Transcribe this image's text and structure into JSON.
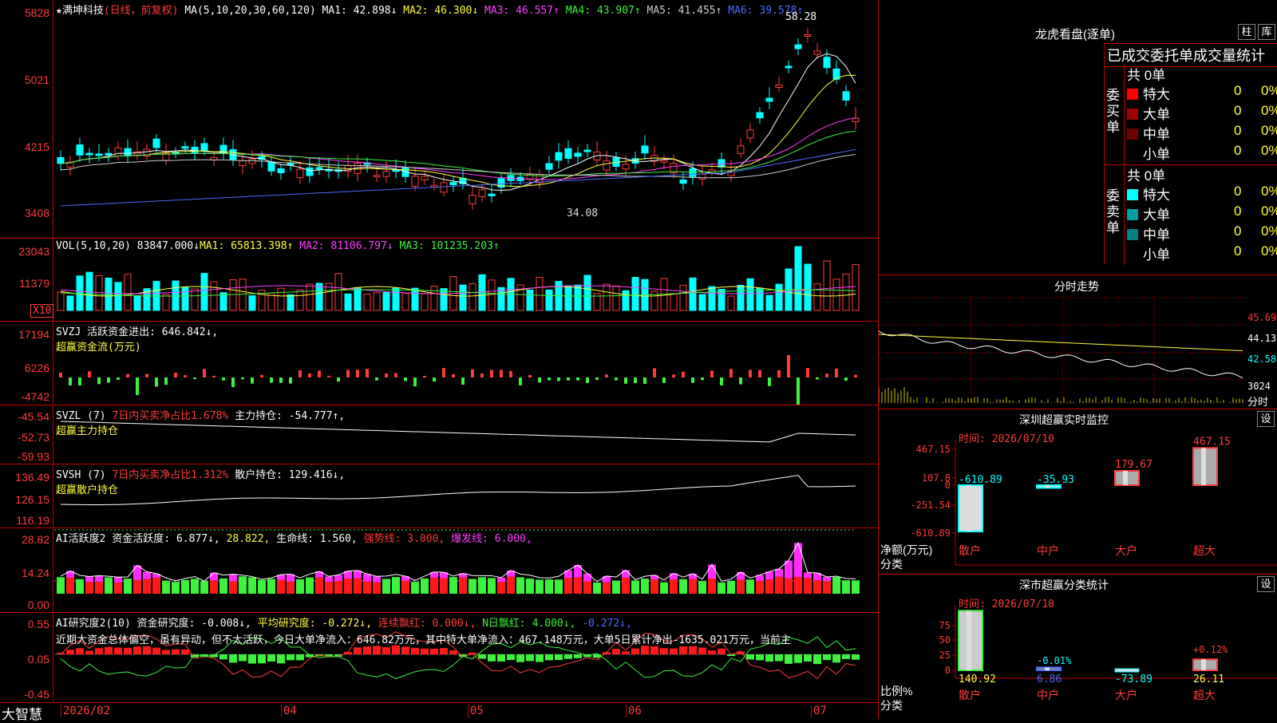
{
  "brand": "大智慧",
  "stock": {
    "name": "★满坤科技",
    "period": "(日线，前复权)"
  },
  "main": {
    "ma_label": "MA(5,10,20,30,60,120)",
    "ma": [
      {
        "label": "MA1: 42.898↓",
        "color": "#ffffff"
      },
      {
        "label": "MA2: 46.300↓",
        "color": "#ffff3c"
      },
      {
        "label": "MA3: 46.557↑",
        "color": "#ff40ff"
      },
      {
        "label": "MA4: 43.907↑",
        "color": "#3cf23c"
      },
      {
        "label": "MA5: 41.455↑",
        "color": "#cccccc"
      },
      {
        "label": "MA6: 39.578↑",
        "color": "#4b6bff"
      }
    ],
    "yticks": [
      "5828",
      "5021",
      "4215",
      "3408"
    ],
    "high_label": "58.28",
    "low_label": "34.08"
  },
  "vol": {
    "label": "VOL(5,10,20)",
    "value": "83847.000↓",
    "ma": [
      {
        "label": "MA1: 65813.398↑",
        "color": "#ffff3c"
      },
      {
        "label": "MA2: 81106.797↓",
        "color": "#ff40ff"
      },
      {
        "label": "MA3: 101235.203↑",
        "color": "#3cf23c"
      }
    ],
    "yticks": [
      "23043",
      "11379"
    ],
    "unit": "X10"
  },
  "svzj": {
    "line1": "SVZJ  活跃资金进出: 646.842↓,",
    "line2": "超赢资金流(万元)",
    "yticks": [
      "17194",
      "6226",
      "-4742"
    ]
  },
  "svzl": {
    "prefix": "SVZL (7)",
    "mid": "7日内买卖净占比1.678%",
    "tail": "主力持仓: -54.777↑,",
    "line2": "超赢主力持仓",
    "yticks": [
      "-45.54",
      "-52.73",
      "-59.93"
    ]
  },
  "svsh": {
    "prefix": "SVSH (7)",
    "mid": "7日内买卖净占比1.312%",
    "tail": "散户持仓: 129.416↓,",
    "line2": "超赢散户持仓",
    "yticks": [
      "136.49",
      "126.15",
      "116.19"
    ]
  },
  "ai1": {
    "p1": "AI活跃度2 资金活跃度: 6.877↓,",
    "p2": "28.822,",
    "p3": "生命线: 1.560,",
    "p4": "强势线: 3.000,",
    "p5": "爆发线: 6.000,",
    "yticks": [
      "28.82",
      "14.24",
      "0.00"
    ]
  },
  "ai2": {
    "p1": "AI研究度2(10) 资金研究度: -0.008↓,",
    "p2": "平均研究度: -0.272↓,",
    "p3": "连续飘红: 0.000↓,",
    "p4": "N日飘红: 4.000↓,",
    "p5": "-0.272↓,",
    "desc": "近期大资金总体偏空，虽有异动，但不太活跃，今日大单净流入：646.82万元，其中特大单净流入：467.148万元，大单5日累计净出-1635.021万元，当前主",
    "yticks": [
      "0.55",
      "0.05",
      "-0.45"
    ]
  },
  "xaxis": [
    "2026/02",
    "04",
    "05",
    "06",
    "07"
  ],
  "lhb": {
    "title": "龙虎看盘(逐单)",
    "btn1": "柱",
    "btn2": "库",
    "tabs": "已成交委托单成交量统计",
    "buy_label": "委买单",
    "sell_label": "委卖单",
    "buy_total": "共 0单",
    "sell_total": "共 0单",
    "buy": [
      {
        "name": "特大",
        "count": "0",
        "pct": "0%",
        "color": "#ff0000"
      },
      {
        "name": "大单",
        "count": "0",
        "pct": "0%",
        "color": "#a00000"
      },
      {
        "name": "中单",
        "count": "0",
        "pct": "0%",
        "color": "#700000"
      },
      {
        "name": "小单",
        "count": "0",
        "pct": "0%",
        "color": "#000000"
      }
    ],
    "sell": [
      {
        "name": "特大",
        "count": "0",
        "pct": "0%",
        "color": "#00ffff"
      },
      {
        "name": "大单",
        "count": "0",
        "pct": "0%",
        "color": "#00a0a0"
      },
      {
        "name": "中单",
        "count": "0",
        "pct": "0%",
        "color": "#008080"
      },
      {
        "name": "小单",
        "count": "0",
        "pct": "0%",
        "color": "#000000"
      }
    ]
  },
  "fenshi": {
    "title": "分时走势",
    "yticks": [
      "45.69",
      "44.13",
      "42.58"
    ],
    "vol_tick": "3024",
    "unit": "分时"
  },
  "szjk": {
    "title": "深圳超赢实时监控",
    "btn": "设",
    "date": "时间: 2026/07/10",
    "yticks": [
      "467.15",
      "107.8",
      "0",
      "-251.54",
      "-610.89"
    ],
    "ylabel": "净额(万元)",
    "xlabel": "分类",
    "categories": [
      "散户",
      "中户",
      "大户",
      "超大"
    ],
    "values": [
      -610.89,
      -35.93,
      179.67,
      467.15
    ],
    "value_labels": [
      "-610.89",
      "-35.93",
      "179.67",
      "467.15"
    ]
  },
  "flfl": {
    "title": "深市超赢分类统计",
    "btn": "设",
    "date": "时间: 2026/07/10",
    "yticks": [
      "75",
      "50",
      "25",
      "0"
    ],
    "ylabel": "比例%",
    "xlabel": "分类",
    "categories": [
      "散户",
      "中户",
      "大户",
      "超大"
    ],
    "values": [
      140.92,
      6.86,
      -73.89,
      26.11
    ],
    "value_labels": [
      "140.92",
      "6.86",
      "-73.89",
      "26.11"
    ],
    "pct_labels": [
      "",
      "-0.01%",
      "",
      "+0.12%"
    ]
  },
  "chart_data": [
    {
      "type": "candlestick",
      "name": "price",
      "ylim": [
        3408,
        5828
      ],
      "note_high": "58.28",
      "note_low": "34.08"
    },
    {
      "type": "bar",
      "title": "深圳超赢实时监控",
      "categories": [
        "散户",
        "中户",
        "大户",
        "超大"
      ],
      "values": [
        -610.89,
        -35.93,
        179.67,
        467.15
      ],
      "ylabel": "净额(万元)",
      "xlabel": "分类"
    },
    {
      "type": "bar",
      "title": "深市超赢分类统计",
      "categories": [
        "散户",
        "中户",
        "大户",
        "超大"
      ],
      "values": [
        140.92,
        6.86,
        -73.89,
        26.11
      ],
      "ylabel": "比例%",
      "xlabel": "分类"
    }
  ]
}
